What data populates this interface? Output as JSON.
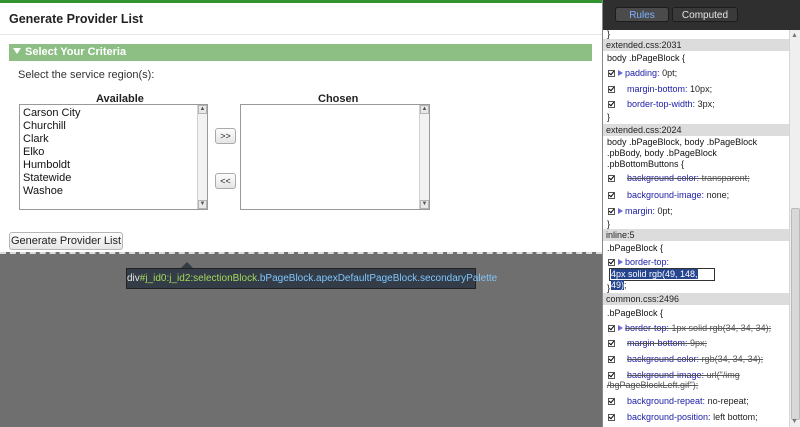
{
  "page": {
    "title": "Generate Provider List",
    "section_header": "Select Your Criteria",
    "criteria_label": "Select the service region(s):",
    "available_header": "Available",
    "chosen_header": "Chosen",
    "available_items": [
      "Carson City",
      "Churchill",
      "Clark",
      "Elko",
      "Humboldt",
      "Statewide",
      "Washoe"
    ],
    "add_button": ">>",
    "remove_button": "<<",
    "generate_button": "Generate Provider List",
    "accent_color": "#319431"
  },
  "tooltip": {
    "tag": "div",
    "id": "#j_id0:j_id2:selectionBlock",
    "classes": ".bPageBlock.apexDefaultPageBlock.secondaryPalette"
  },
  "devtools": {
    "tabs": {
      "rules": "Rules",
      "computed": "Computed"
    },
    "top_brace": "}",
    "rules": [
      {
        "source": "extended.css:2031",
        "selector": "body .bPageBlock {",
        "props": [
          {
            "name": "padding:",
            "value": "0pt;",
            "expandable": true,
            "struck": false
          },
          {
            "name": "margin-bottom:",
            "value": "10px;",
            "expandable": false,
            "struck": false
          },
          {
            "name": "border-top-width:",
            "value": "3px;",
            "expandable": false,
            "struck": false
          }
        ],
        "close": "}"
      },
      {
        "source": "extended.css:2024",
        "selector_lines": [
          "body .bPageBlock, body .bPageBlock",
          ".pbBody, body .bPageBlock",
          ".pbBottomButtons {"
        ],
        "props": [
          {
            "name": "background-color:",
            "value": "transparent;",
            "expandable": false,
            "struck": true
          },
          {
            "name": "background-image:",
            "value": "none;",
            "expandable": false,
            "struck": false
          },
          {
            "name": "margin:",
            "value": "0pt;",
            "expandable": true,
            "struck": false
          }
        ],
        "close": "}"
      },
      {
        "source": "inline:5",
        "selector": ".bPageBlock {",
        "props": [
          {
            "name": "border-top:",
            "value": "",
            "expandable": true,
            "struck": false
          }
        ],
        "edit_value": "4px solid rgb(49, 148, 49)",
        "edit_suffix": ";",
        "close": "}"
      },
      {
        "source": "common.css:2496",
        "selector": ".bPageBlock {",
        "props": [
          {
            "name": "border-top:",
            "value": "1px solid rgb(34, 34, 34);",
            "expandable": true,
            "struck": true
          },
          {
            "name": "margin-bottom:",
            "value": "9px;",
            "expandable": false,
            "struck": true
          },
          {
            "name": "background-color:",
            "value": "rgb(34, 34, 34);",
            "expandable": false,
            "struck": true
          },
          {
            "name": "background-image:",
            "value": "url(\"/img",
            "expandable": false,
            "struck": true
          },
          {
            "name": "background-repeat:",
            "value": "no-repeat;",
            "expandable": false,
            "struck": false
          },
          {
            "name": "background-position:",
            "value": "left bottom;",
            "expandable": false,
            "struck": false
          }
        ],
        "wrap_line": "/bgPageBlockLeft.gif\");"
      }
    ]
  }
}
